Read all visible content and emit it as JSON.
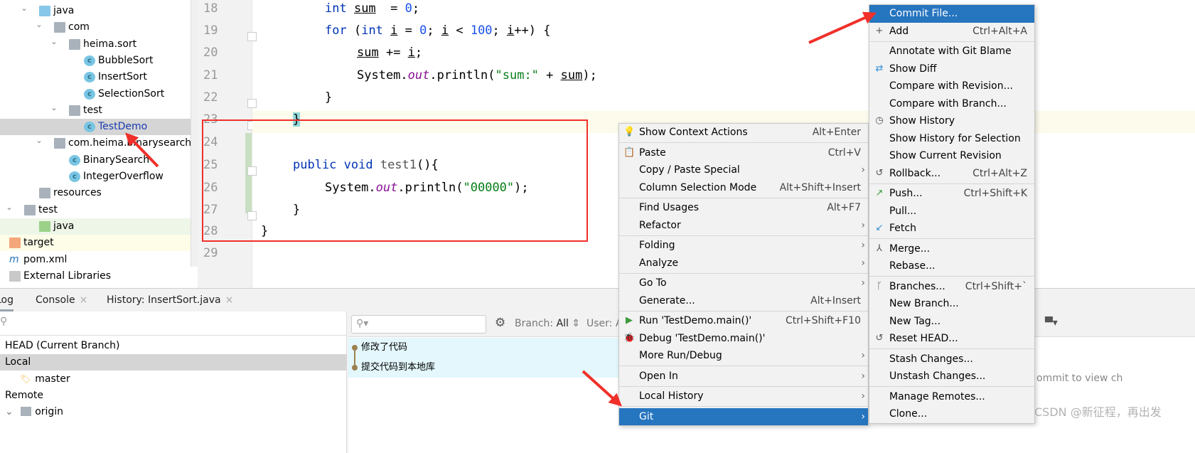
{
  "project_tree": [
    {
      "label": "java",
      "depth": 1,
      "icon": "source-folder-icon",
      "expanded": true
    },
    {
      "label": "com",
      "depth": 2,
      "icon": "package-icon",
      "expanded": true
    },
    {
      "label": "heima.sort",
      "depth": 3,
      "icon": "package-icon",
      "expanded": true
    },
    {
      "label": "BubbleSort",
      "depth": 4,
      "icon": "class-icon"
    },
    {
      "label": "InsertSort",
      "depth": 4,
      "icon": "class-icon"
    },
    {
      "label": "SelectionSort",
      "depth": 4,
      "icon": "class-icon"
    },
    {
      "label": "test",
      "depth": 3,
      "icon": "package-icon",
      "expanded": true
    },
    {
      "label": "TestDemo",
      "depth": 4,
      "icon": "class-icon",
      "selected": true
    },
    {
      "label": "com.heima.binarysearch",
      "depth": 2,
      "icon": "package-icon",
      "expanded": true
    },
    {
      "label": "BinarySearch",
      "depth": 3,
      "icon": "class-icon"
    },
    {
      "label": "IntegerOverflow",
      "depth": 3,
      "icon": "class-icon"
    },
    {
      "label": "resources",
      "depth": 1,
      "icon": "resources-folder-icon"
    },
    {
      "label": "test",
      "depth": 0,
      "icon": "folder-icon",
      "expanded": true
    },
    {
      "label": "java",
      "depth": 1,
      "icon": "test-source-folder-icon"
    },
    {
      "label": "target",
      "depth": -1,
      "icon": "excluded-folder-icon"
    },
    {
      "label": "pom.xml",
      "depth": -1,
      "icon": "maven-icon"
    },
    {
      "label": "External Libraries",
      "depth": -1,
      "icon": "library-icon"
    }
  ],
  "editor": {
    "line_numbers": [
      "18",
      "19",
      "20",
      "21",
      "22",
      "23",
      "24",
      "25",
      "26",
      "27",
      "28",
      "29"
    ],
    "lines": [
      [
        [
          "kw",
          "int "
        ],
        [
          "u",
          "sum"
        ],
        [
          "",
          "  = "
        ],
        [
          "num",
          "0"
        ],
        [
          "",
          ";"
        ]
      ],
      [
        [
          "kw",
          "for "
        ],
        [
          "",
          "("
        ],
        [
          "kw",
          "int "
        ],
        [
          "u",
          "i"
        ],
        [
          "",
          " = "
        ],
        [
          "num",
          "0"
        ],
        [
          "",
          "; "
        ],
        [
          "u",
          "i"
        ],
        [
          "",
          " < "
        ],
        [
          "num",
          "100"
        ],
        [
          "",
          "; "
        ],
        [
          "u",
          "i"
        ],
        [
          "",
          "++) {"
        ]
      ],
      [
        [
          "u",
          "sum"
        ],
        [
          "",
          " += "
        ],
        [
          "u",
          "i"
        ],
        [
          "",
          ";"
        ]
      ],
      [
        [
          "",
          "System."
        ],
        [
          "it",
          "out"
        ],
        [
          "",
          ".println("
        ],
        [
          "str",
          "\"sum:\""
        ],
        [
          "",
          " + "
        ],
        [
          "u",
          "sum"
        ],
        [
          "",
          ");"
        ]
      ],
      [
        [
          "",
          "}"
        ]
      ],
      [
        [
          "",
          "}"
        ]
      ],
      [],
      [
        [
          "kw",
          "public void "
        ],
        [
          "fn",
          "test1"
        ],
        [
          "",
          "(){"
        ]
      ],
      [
        [
          "",
          "System."
        ],
        [
          "it",
          "out"
        ],
        [
          "",
          ".println("
        ],
        [
          "str",
          "\"00000\""
        ],
        [
          "",
          ");"
        ]
      ],
      [
        [
          "",
          "}"
        ]
      ],
      [
        [
          "",
          "}"
        ]
      ],
      []
    ],
    "indents": [
      2,
      2,
      3,
      3,
      2,
      1,
      0,
      1,
      2,
      1,
      0,
      0
    ]
  },
  "bottom": {
    "tabs": [
      {
        "label": "Log",
        "active": true
      },
      {
        "label": "Console",
        "closable": true
      },
      {
        "label": "History: InsertSort.java",
        "closable": true
      }
    ],
    "branches": [
      {
        "label": "HEAD (Current Branch)"
      },
      {
        "label": "Local",
        "selected": true
      },
      {
        "label": "master",
        "icon": "tag-icon"
      },
      {
        "label": "Remote"
      },
      {
        "label": "origin",
        "icon": "folder-icon"
      }
    ],
    "toolbar": {
      "branch_label": "Branch:",
      "branch_value": "All",
      "user_label": "User: A"
    },
    "commits": [
      "修改了代码",
      "提交代码到本地库"
    ],
    "details_hint": "ommit to view ch"
  },
  "context_menu": [
    {
      "label": "Show Context Actions",
      "shortcut": "Alt+Enter",
      "icon": "bulb-icon"
    },
    {
      "sep": true
    },
    {
      "label": "Paste",
      "shortcut": "Ctrl+V",
      "icon": "paste-icon"
    },
    {
      "label": "Copy / Paste Special",
      "submenu": true
    },
    {
      "label": "Column Selection Mode",
      "shortcut": "Alt+Shift+Insert"
    },
    {
      "sep": true
    },
    {
      "label": "Find Usages",
      "shortcut": "Alt+F7"
    },
    {
      "label": "Refactor",
      "submenu": true
    },
    {
      "sep": true
    },
    {
      "label": "Folding",
      "submenu": true
    },
    {
      "label": "Analyze",
      "submenu": true
    },
    {
      "sep": true
    },
    {
      "label": "Go To",
      "submenu": true
    },
    {
      "label": "Generate...",
      "shortcut": "Alt+Insert"
    },
    {
      "sep": true
    },
    {
      "label": "Run 'TestDemo.main()'",
      "shortcut": "Ctrl+Shift+F10",
      "icon": "run-icon"
    },
    {
      "label": "Debug 'TestDemo.main()'",
      "icon": "debug-icon"
    },
    {
      "label": "More Run/Debug",
      "submenu": true
    },
    {
      "sep": true
    },
    {
      "label": "Open In",
      "submenu": true
    },
    {
      "sep": true
    },
    {
      "label": "Local History",
      "submenu": true
    },
    {
      "sep": true
    },
    {
      "label": "Git",
      "submenu": true,
      "selected": true
    }
  ],
  "git_menu": [
    {
      "label": "Commit File...",
      "selected": true
    },
    {
      "label": "Add",
      "shortcut": "Ctrl+Alt+A",
      "icon": "plus-icon"
    },
    {
      "sep": true
    },
    {
      "label": "Annotate with Git Blame"
    },
    {
      "label": "Show Diff",
      "icon": "diff-icon"
    },
    {
      "label": "Compare with Revision..."
    },
    {
      "label": "Compare with Branch..."
    },
    {
      "label": "Show History",
      "icon": "clock-icon"
    },
    {
      "label": "Show History for Selection"
    },
    {
      "label": "Show Current Revision"
    },
    {
      "label": "Rollback...",
      "shortcut": "Ctrl+Alt+Z",
      "icon": "rollback-icon"
    },
    {
      "sep": true
    },
    {
      "label": "Push...",
      "shortcut": "Ctrl+Shift+K",
      "icon": "push-icon"
    },
    {
      "label": "Pull..."
    },
    {
      "label": "Fetch",
      "icon": "fetch-icon"
    },
    {
      "sep": true
    },
    {
      "label": "Merge...",
      "icon": "merge-icon"
    },
    {
      "label": "Rebase..."
    },
    {
      "sep": true
    },
    {
      "label": "Branches...",
      "shortcut": "Ctrl+Shift+`",
      "icon": "branch-icon"
    },
    {
      "label": "New Branch..."
    },
    {
      "label": "New Tag..."
    },
    {
      "label": "Reset HEAD...",
      "icon": "rollback-icon"
    },
    {
      "sep": true
    },
    {
      "label": "Stash Changes..."
    },
    {
      "label": "Unstash Changes..."
    },
    {
      "sep": true
    },
    {
      "label": "Manage Remotes..."
    },
    {
      "label": "Clone..."
    }
  ],
  "watermark": "CSDN @新征程，再出发",
  "colors": {
    "selection": "#2675bf",
    "annotation": "#f0302a"
  }
}
